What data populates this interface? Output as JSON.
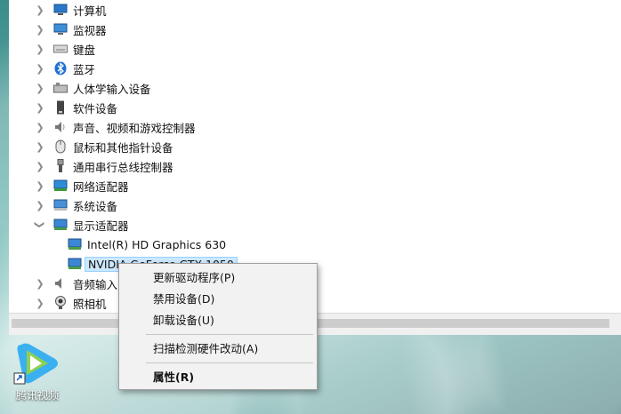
{
  "device_tree": {
    "categories": [
      {
        "label": "计算机",
        "icon": "computer-icon",
        "expanded": false
      },
      {
        "label": "监视器",
        "icon": "monitor-icon",
        "expanded": false
      },
      {
        "label": "键盘",
        "icon": "keyboard-icon",
        "expanded": false
      },
      {
        "label": "蓝牙",
        "icon": "bluetooth-icon",
        "expanded": false
      },
      {
        "label": "人体学输入设备",
        "icon": "hid-icon",
        "expanded": false
      },
      {
        "label": "软件设备",
        "icon": "software-device-icon",
        "expanded": false
      },
      {
        "label": "声音、视频和游戏控制器",
        "icon": "speaker-icon",
        "expanded": false
      },
      {
        "label": "鼠标和其他指针设备",
        "icon": "mouse-icon",
        "expanded": false
      },
      {
        "label": "通用串行总线控制器",
        "icon": "usb-icon",
        "expanded": false
      },
      {
        "label": "网络适配器",
        "icon": "network-adapter-icon",
        "expanded": false
      },
      {
        "label": "系统设备",
        "icon": "system-device-icon",
        "expanded": false
      },
      {
        "label": "显示适配器",
        "icon": "display-adapter-icon",
        "expanded": true
      },
      {
        "label": "音频输入",
        "icon": "audio-input-icon",
        "expanded": false
      },
      {
        "label": "照相机",
        "icon": "camera-icon",
        "expanded": false
      }
    ],
    "display_adapters": [
      {
        "label": "Intel(R) HD Graphics 630",
        "selected": false
      },
      {
        "label": "NVIDIA GeForce GTX 1050",
        "selected": true
      }
    ]
  },
  "context_menu": {
    "items": [
      {
        "label": "更新驱动程序(P)",
        "bold": false
      },
      {
        "label": "禁用设备(D)",
        "bold": false
      },
      {
        "label": "卸载设备(U)",
        "bold": false
      },
      {
        "label": "扫描检测硬件改动(A)",
        "bold": false
      },
      {
        "label": "属性(R)",
        "bold": true
      }
    ]
  },
  "desktop": {
    "shortcut_label": "腾讯视频"
  },
  "colors": {
    "selection_bg": "#cce8ff",
    "selection_border": "#99d1ff",
    "menu_bg": "#f2f2f2",
    "window_bg": "#ffffff"
  }
}
